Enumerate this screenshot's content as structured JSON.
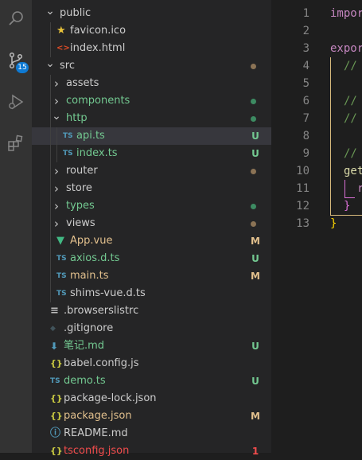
{
  "activity_bar": {
    "scm_badge": "15",
    "icons": [
      "search-icon",
      "source-control-icon",
      "run-debug-icon",
      "extensions-icon"
    ]
  },
  "explorer": {
    "rows": [
      {
        "name": "public",
        "type": "folder",
        "expanded": true,
        "depth": 1,
        "color": "#cccccc",
        "status": "",
        "status_color": ""
      },
      {
        "name": "favicon.ico",
        "type": "star",
        "depth": 2,
        "color": "#cccccc",
        "status": "",
        "status_color": ""
      },
      {
        "name": "index.html",
        "type": "html",
        "depth": 2,
        "color": "#cccccc",
        "status": "",
        "status_color": ""
      },
      {
        "name": "src",
        "type": "folder",
        "expanded": true,
        "depth": 1,
        "color": "#cccccc",
        "status": "dot",
        "status_color": "#8b7355"
      },
      {
        "name": "assets",
        "type": "folder",
        "expanded": false,
        "depth": 2,
        "color": "#cccccc",
        "status": "",
        "status_color": ""
      },
      {
        "name": "components",
        "type": "folder",
        "expanded": false,
        "depth": 2,
        "color": "#73c991",
        "status": "dot",
        "status_color": "#3d8b62"
      },
      {
        "name": "http",
        "type": "folder",
        "expanded": true,
        "depth": 2,
        "color": "#73c991",
        "status": "dot",
        "status_color": "#3d8b62"
      },
      {
        "name": "api.ts",
        "type": "ts",
        "depth": 3,
        "color": "#73c991",
        "status": "U",
        "status_color": "#73c991",
        "selected": true
      },
      {
        "name": "index.ts",
        "type": "ts",
        "depth": 3,
        "color": "#73c991",
        "status": "U",
        "status_color": "#73c991"
      },
      {
        "name": "router",
        "type": "folder",
        "expanded": false,
        "depth": 2,
        "color": "#cccccc",
        "status": "dot",
        "status_color": "#8b7355"
      },
      {
        "name": "store",
        "type": "folder",
        "expanded": false,
        "depth": 2,
        "color": "#cccccc",
        "status": "",
        "status_color": ""
      },
      {
        "name": "types",
        "type": "folder",
        "expanded": false,
        "depth": 2,
        "color": "#73c991",
        "status": "dot",
        "status_color": "#3d8b62"
      },
      {
        "name": "views",
        "type": "folder",
        "expanded": false,
        "depth": 2,
        "color": "#cccccc",
        "status": "dot",
        "status_color": "#8b7355"
      },
      {
        "name": "App.vue",
        "type": "vue",
        "depth": 2,
        "color": "#e2c08d",
        "status": "M",
        "status_color": "#e2c08d"
      },
      {
        "name": "axios.d.ts",
        "type": "ts",
        "depth": 2,
        "color": "#73c991",
        "status": "U",
        "status_color": "#73c991"
      },
      {
        "name": "main.ts",
        "type": "ts",
        "depth": 2,
        "color": "#e2c08d",
        "status": "M",
        "status_color": "#e2c08d"
      },
      {
        "name": "shims-vue.d.ts",
        "type": "ts",
        "depth": 2,
        "color": "#cccccc",
        "status": "",
        "status_color": ""
      },
      {
        "name": ".browserslistrc",
        "type": "lines",
        "depth": 1,
        "color": "#cccccc",
        "status": "",
        "status_color": ""
      },
      {
        "name": ".gitignore",
        "type": "git",
        "depth": 1,
        "color": "#cccccc",
        "status": "",
        "status_color": ""
      },
      {
        "name": "笔记.md",
        "type": "md",
        "depth": 1,
        "color": "#73c991",
        "status": "U",
        "status_color": "#73c991"
      },
      {
        "name": "babel.config.js",
        "type": "js",
        "depth": 1,
        "color": "#cccccc",
        "status": "",
        "status_color": ""
      },
      {
        "name": "demo.ts",
        "type": "ts",
        "depth": 1,
        "color": "#73c991",
        "status": "U",
        "status_color": "#73c991"
      },
      {
        "name": "package-lock.json",
        "type": "json",
        "depth": 1,
        "color": "#cccccc",
        "status": "",
        "status_color": ""
      },
      {
        "name": "package.json",
        "type": "json",
        "depth": 1,
        "color": "#e2c08d",
        "status": "M",
        "status_color": "#e2c08d"
      },
      {
        "name": "README.md",
        "type": "info",
        "depth": 1,
        "color": "#cccccc",
        "status": "",
        "status_color": ""
      },
      {
        "name": "tsconfig.json",
        "type": "json",
        "depth": 1,
        "color": "#f14c4c",
        "status": "1",
        "status_color": "#f14c4c"
      }
    ]
  },
  "editor": {
    "line_numbers": [
      "1",
      "2",
      "3",
      "4",
      "5",
      "6",
      "7",
      "8",
      "9",
      "10",
      "11",
      "12",
      "13"
    ],
    "lines": [
      {
        "text": "impor",
        "color": "#c586c0",
        "indent": 0
      },
      {
        "text": "",
        "color": "#d4d4d4",
        "indent": 0
      },
      {
        "text": "expor",
        "color": "#c586c0",
        "indent": 0
      },
      {
        "text": "//",
        "color": "#6a9955",
        "indent": 1
      },
      {
        "text": "",
        "color": "#d4d4d4",
        "indent": 0
      },
      {
        "text": "//",
        "color": "#6a9955",
        "indent": 1
      },
      {
        "text": "//",
        "color": "#6a9955",
        "indent": 1
      },
      {
        "text": "",
        "color": "#d4d4d4",
        "indent": 0
      },
      {
        "text": "//",
        "color": "#6a9955",
        "indent": 1
      },
      {
        "text": "get",
        "color": "#dcdcaa",
        "indent": 1
      },
      {
        "text": "r",
        "color": "#c586c0",
        "indent": 2
      },
      {
        "text": "}",
        "color": "#da70d6",
        "indent": 1
      },
      {
        "text": "}",
        "color": "#ffd700",
        "indent": 0
      }
    ]
  }
}
